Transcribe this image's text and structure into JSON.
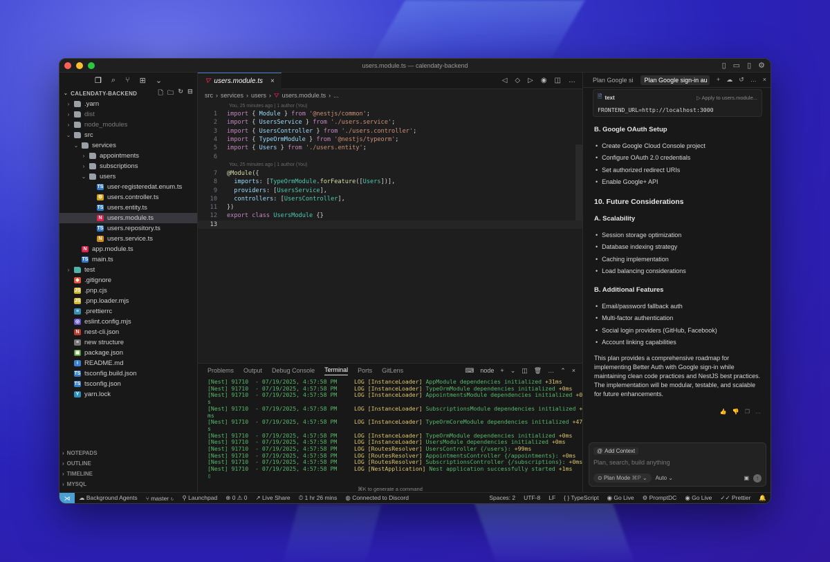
{
  "window": {
    "title": "users.module.ts — calendaty-backend"
  },
  "colors": {
    "accent": "#4a9fd4",
    "close": "#ff5f57",
    "minimize": "#febc2e",
    "maximize": "#28c840"
  },
  "explorer": {
    "root": "CALENDATY-BACKEND",
    "items": [
      {
        "label": ".yarn",
        "depth": 0,
        "type": "folder",
        "chev": "›",
        "dim": false
      },
      {
        "label": "dist",
        "depth": 0,
        "type": "folder",
        "chev": "›",
        "dim": true
      },
      {
        "label": "node_modules",
        "depth": 0,
        "type": "folder",
        "chev": "›",
        "dim": true
      },
      {
        "label": "src",
        "depth": 0,
        "type": "folder",
        "chev": "⌄",
        "dim": false
      },
      {
        "label": "services",
        "depth": 1,
        "type": "folder",
        "chev": "⌄",
        "dim": false
      },
      {
        "label": "appointments",
        "depth": 2,
        "type": "folder",
        "chev": "›",
        "dim": false
      },
      {
        "label": "subscriptions",
        "depth": 2,
        "type": "folder",
        "chev": "›",
        "dim": false
      },
      {
        "label": "users",
        "depth": 2,
        "type": "folder",
        "chev": "⌄",
        "dim": false
      },
      {
        "label": "user-registeredat.enum.ts",
        "depth": 3,
        "type": "ts",
        "chev": "",
        "dim": false
      },
      {
        "label": "users.controller.ts",
        "depth": 3,
        "type": "gear",
        "chev": "",
        "dim": false
      },
      {
        "label": "users.entity.ts",
        "depth": 3,
        "type": "ts",
        "chev": "",
        "dim": false
      },
      {
        "label": "users.module.ts",
        "depth": 3,
        "type": "nest",
        "chev": "",
        "dim": false,
        "active": true
      },
      {
        "label": "users.repository.ts",
        "depth": 3,
        "type": "ts",
        "chev": "",
        "dim": false
      },
      {
        "label": "users.service.ts",
        "depth": 3,
        "type": "nest2",
        "chev": "",
        "dim": false
      },
      {
        "label": "app.module.ts",
        "depth": 1,
        "type": "nest",
        "chev": "",
        "dim": false
      },
      {
        "label": "main.ts",
        "depth": 1,
        "type": "ts",
        "chev": "",
        "dim": false
      },
      {
        "label": "test",
        "depth": 0,
        "type": "tfolder",
        "chev": "›",
        "dim": false
      },
      {
        "label": ".gitignore",
        "depth": 0,
        "type": "git",
        "chev": "",
        "dim": false
      },
      {
        "label": ".pnp.cjs",
        "depth": 0,
        "type": "js",
        "chev": "",
        "dim": false
      },
      {
        "label": ".pnp.loader.mjs",
        "depth": 0,
        "type": "js",
        "chev": "",
        "dim": false
      },
      {
        "label": ".prettierrc",
        "depth": 0,
        "type": "prettier",
        "chev": "",
        "dim": false
      },
      {
        "label": "eslint.config.mjs",
        "depth": 0,
        "type": "eslint",
        "chev": "",
        "dim": false
      },
      {
        "label": "nest-cli.json",
        "depth": 0,
        "type": "nestjson",
        "chev": "",
        "dim": false
      },
      {
        "label": "new structure",
        "depth": 0,
        "type": "lines",
        "chev": "",
        "dim": false
      },
      {
        "label": "package.json",
        "depth": 0,
        "type": "pkg",
        "chev": "",
        "dim": false
      },
      {
        "label": "README.md",
        "depth": 0,
        "type": "info",
        "chev": "",
        "dim": false
      },
      {
        "label": "tsconfig.build.json",
        "depth": 0,
        "type": "ts",
        "chev": "",
        "dim": false
      },
      {
        "label": "tsconfig.json",
        "depth": 0,
        "type": "ts",
        "chev": "",
        "dim": false
      },
      {
        "label": "yarn.lock",
        "depth": 0,
        "type": "yarn",
        "chev": "",
        "dim": false
      }
    ],
    "sections": [
      "NOTEPADS",
      "OUTLINE",
      "TIMELINE",
      "MYSQL"
    ]
  },
  "editor": {
    "tab": "users.module.ts",
    "breadcrumb": [
      "src",
      "services",
      "users",
      "users.module.ts",
      "..."
    ],
    "blame1": "You, 25 minutes ago | 1 author (You)",
    "blame2": "You, 25 minutes ago | 1 author (You)",
    "lines": [
      {
        "n": "1",
        "html": "<span class='kw'>import</span> <span class='pn'>{ </span><span class='id'>Module</span><span class='pn'> } </span><span class='kw'>from</span> <span class='str'>'@nestjs/common'</span><span class='pn'>;</span>"
      },
      {
        "n": "2",
        "html": "<span class='kw'>import</span> <span class='pn'>{ </span><span class='id'>UsersService</span><span class='pn'> } </span><span class='kw'>from</span> <span class='str'>'./users.service'</span><span class='pn'>;</span>"
      },
      {
        "n": "3",
        "html": "<span class='kw'>import</span> <span class='pn'>{ </span><span class='id'>UsersController</span><span class='pn'> } </span><span class='kw'>from</span> <span class='str'>'./users.controller'</span><span class='pn'>;</span>"
      },
      {
        "n": "4",
        "html": "<span class='kw'>import</span> <span class='pn'>{ </span><span class='id'>TypeOrmModule</span><span class='pn'> } </span><span class='kw'>from</span> <span class='str'>'@nestjs/typeorm'</span><span class='pn'>;</span>"
      },
      {
        "n": "5",
        "html": "<span class='kw'>import</span> <span class='pn'>{ </span><span class='id'>Users</span><span class='pn'> } </span><span class='kw'>from</span> <span class='str'>'./users.entity'</span><span class='pn'>;</span>"
      },
      {
        "n": "6",
        "html": "",
        "blame": true
      },
      {
        "n": "7",
        "html": "<span class='dec'>@Module</span><span class='pn'>({</span>"
      },
      {
        "n": "8",
        "html": "  <span class='id'>imports</span><span class='pn'>: [</span><span class='cls'>TypeOrmModule</span><span class='pn'>.</span><span class='fn'>forFeature</span><span class='pn'>([</span><span class='cls'>Users</span><span class='pn'>])],</span>"
      },
      {
        "n": "9",
        "html": "  <span class='id'>providers</span><span class='pn'>: [</span><span class='cls'>UsersService</span><span class='pn'>],</span>"
      },
      {
        "n": "10",
        "html": "  <span class='id'>controllers</span><span class='pn'>: [</span><span class='cls'>UsersController</span><span class='pn'>],</span>"
      },
      {
        "n": "11",
        "html": "<span class='pn'>})</span>"
      },
      {
        "n": "12",
        "html": "<span class='kw'>export</span> <span class='kw'>class</span> <span class='cls'>UsersModule</span> <span class='pn'>{}</span>"
      },
      {
        "n": "13",
        "html": "",
        "cur": true
      }
    ]
  },
  "panel": {
    "tabs": [
      "Problems",
      "Output",
      "Debug Console",
      "Terminal",
      "Ports",
      "GitLens"
    ],
    "active_tab": "Terminal",
    "shell": "node",
    "hint": "⌘K to generate a command",
    "lines": [
      {
        "pre": "[Nest] 91710  - 07/19/2025, 4:57:58 PM     ",
        "ctx": "LOG [InstanceLoader] ",
        "msg": "AppModule dependencies initialized ",
        "tm": "+31ms"
      },
      {
        "pre": "[Nest] 91710  - 07/19/2025, 4:57:58 PM     ",
        "ctx": "LOG [InstanceLoader] ",
        "msg": "TypeOrmModule dependencies initialized ",
        "tm": "+0ms"
      },
      {
        "pre": "[Nest] 91710  - 07/19/2025, 4:57:58 PM     ",
        "ctx": "LOG [InstanceLoader] ",
        "msg": "AppointmentsModule dependencies initialized ",
        "tm": "+0m"
      },
      {
        "pre": "s",
        "ctx": "",
        "msg": "",
        "tm": ""
      },
      {
        "pre": "[Nest] 91710  - 07/19/2025, 4:57:58 PM     ",
        "ctx": "LOG [InstanceLoader] ",
        "msg": "SubscriptionsModule dependencies initialized ",
        "tm": "+0"
      },
      {
        "pre": "ms",
        "ctx": "",
        "msg": "",
        "tm": ""
      },
      {
        "pre": "[Nest] 91710  - 07/19/2025, 4:57:58 PM     ",
        "ctx": "LOG [InstanceLoader] ",
        "msg": "TypeOrmCoreModule dependencies initialized ",
        "tm": "+47m"
      },
      {
        "pre": "s",
        "ctx": "",
        "msg": "",
        "tm": ""
      },
      {
        "pre": "[Nest] 91710  - 07/19/2025, 4:57:58 PM     ",
        "ctx": "LOG [InstanceLoader] ",
        "msg": "TypeOrmModule dependencies initialized ",
        "tm": "+0ms"
      },
      {
        "pre": "[Nest] 91710  - 07/19/2025, 4:57:58 PM     ",
        "ctx": "LOG [InstanceLoader] ",
        "msg": "UsersModule dependencies initialized ",
        "tm": "+0ms"
      },
      {
        "pre": "[Nest] 91710  - 07/19/2025, 4:57:58 PM     ",
        "ctx": "LOG [RoutesResolver] ",
        "msg": "UsersController {/users}: ",
        "tm": "+99ms"
      },
      {
        "pre": "[Nest] 91710  - 07/19/2025, 4:57:58 PM     ",
        "ctx": "LOG [RoutesResolver] ",
        "msg": "AppointmentsController {/appointments}: ",
        "tm": "+0ms"
      },
      {
        "pre": "[Nest] 91710  - 07/19/2025, 4:57:58 PM     ",
        "ctx": "LOG [RoutesResolver] ",
        "msg": "SubscriptionsController {/subscriptions}: ",
        "tm": "+0ms"
      },
      {
        "pre": "[Nest] 91710  - 07/19/2025, 4:57:58 PM     ",
        "ctx": "LOG [NestApplication] ",
        "msg": "Nest application successfully started ",
        "tm": "+1ms"
      },
      {
        "pre": "▯",
        "ctx": "",
        "msg": "",
        "tm": ""
      }
    ]
  },
  "chat": {
    "tabs": [
      "Plan Google si",
      "Plan Google sign-in au"
    ],
    "code_lang": "text",
    "apply": "Apply to users.module...",
    "code": "FRONTEND_URL=http://localhost:3000",
    "blocks": [
      {
        "kind": "h3",
        "text": "B. Google OAuth Setup"
      },
      {
        "kind": "li",
        "text": "Create Google Cloud Console project"
      },
      {
        "kind": "li",
        "text": "Configure OAuth 2.0 credentials"
      },
      {
        "kind": "li",
        "text": "Set authorized redirect URIs"
      },
      {
        "kind": "li",
        "text": "Enable Google+ API"
      },
      {
        "kind": "h2",
        "text": "10. Future Considerations"
      },
      {
        "kind": "h3",
        "text": "A. Scalability"
      },
      {
        "kind": "li",
        "text": "Session storage optimization"
      },
      {
        "kind": "li",
        "text": "Database indexing strategy"
      },
      {
        "kind": "li",
        "text": "Caching implementation"
      },
      {
        "kind": "li",
        "text": "Load balancing considerations"
      },
      {
        "kind": "h3",
        "text": "B. Additional Features"
      },
      {
        "kind": "li",
        "text": "Email/password fallback auth"
      },
      {
        "kind": "li",
        "text": "Multi-factor authentication"
      },
      {
        "kind": "li",
        "text": "Social login providers (GitHub, Facebook)"
      },
      {
        "kind": "li",
        "text": "Account linking capabilities"
      },
      {
        "kind": "p",
        "text": "This plan provides a comprehensive roadmap for implementing Better Auth with Google sign-in while maintaining clean code practices and NestJS best practices. The implementation will be modular, testable, and scalable for future enhancements."
      }
    ],
    "add_context": "Add Context",
    "placeholder": "Plan, search, build anything",
    "mode": "Plan Mode",
    "mode_shortcut": "⌘P",
    "model": "Auto"
  },
  "status": {
    "left": [
      "Background Agents",
      "master",
      "Launchpad",
      "0",
      "0",
      "Live Share",
      "1 hr 26 mins",
      "Connected to Discord"
    ],
    "right": [
      "Spaces: 2",
      "UTF-8",
      "LF",
      "TypeScript",
      "Go Live",
      "PromptDC",
      "Go Live",
      "Prettier"
    ]
  }
}
